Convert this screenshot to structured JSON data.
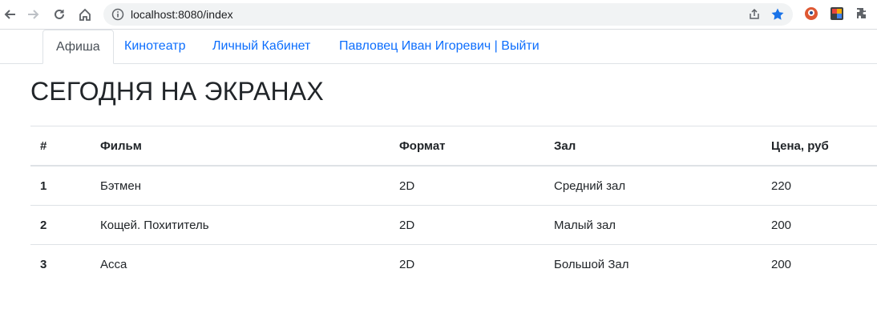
{
  "browser": {
    "url": "localhost:8080/index"
  },
  "tabs": [
    {
      "label": "Афиша"
    },
    {
      "label": "Кинотеатр"
    },
    {
      "label": "Личный Кабинет"
    },
    {
      "label": "Павловец Иван Игоревич | Выйти"
    }
  ],
  "page": {
    "title": "СЕГОДНЯ НА ЭКРАНАХ"
  },
  "table": {
    "headers": [
      "#",
      "Фильм",
      "Формат",
      "Зал",
      "Цена, руб"
    ],
    "rows": [
      [
        "1",
        "Бэтмен",
        "2D",
        "Средний зал",
        "220"
      ],
      [
        "2",
        "Кощей. Похититель",
        "2D",
        "Малый зал",
        "200"
      ],
      [
        "3",
        "Асса",
        "2D",
        "Большой Зал",
        "200"
      ]
    ]
  }
}
